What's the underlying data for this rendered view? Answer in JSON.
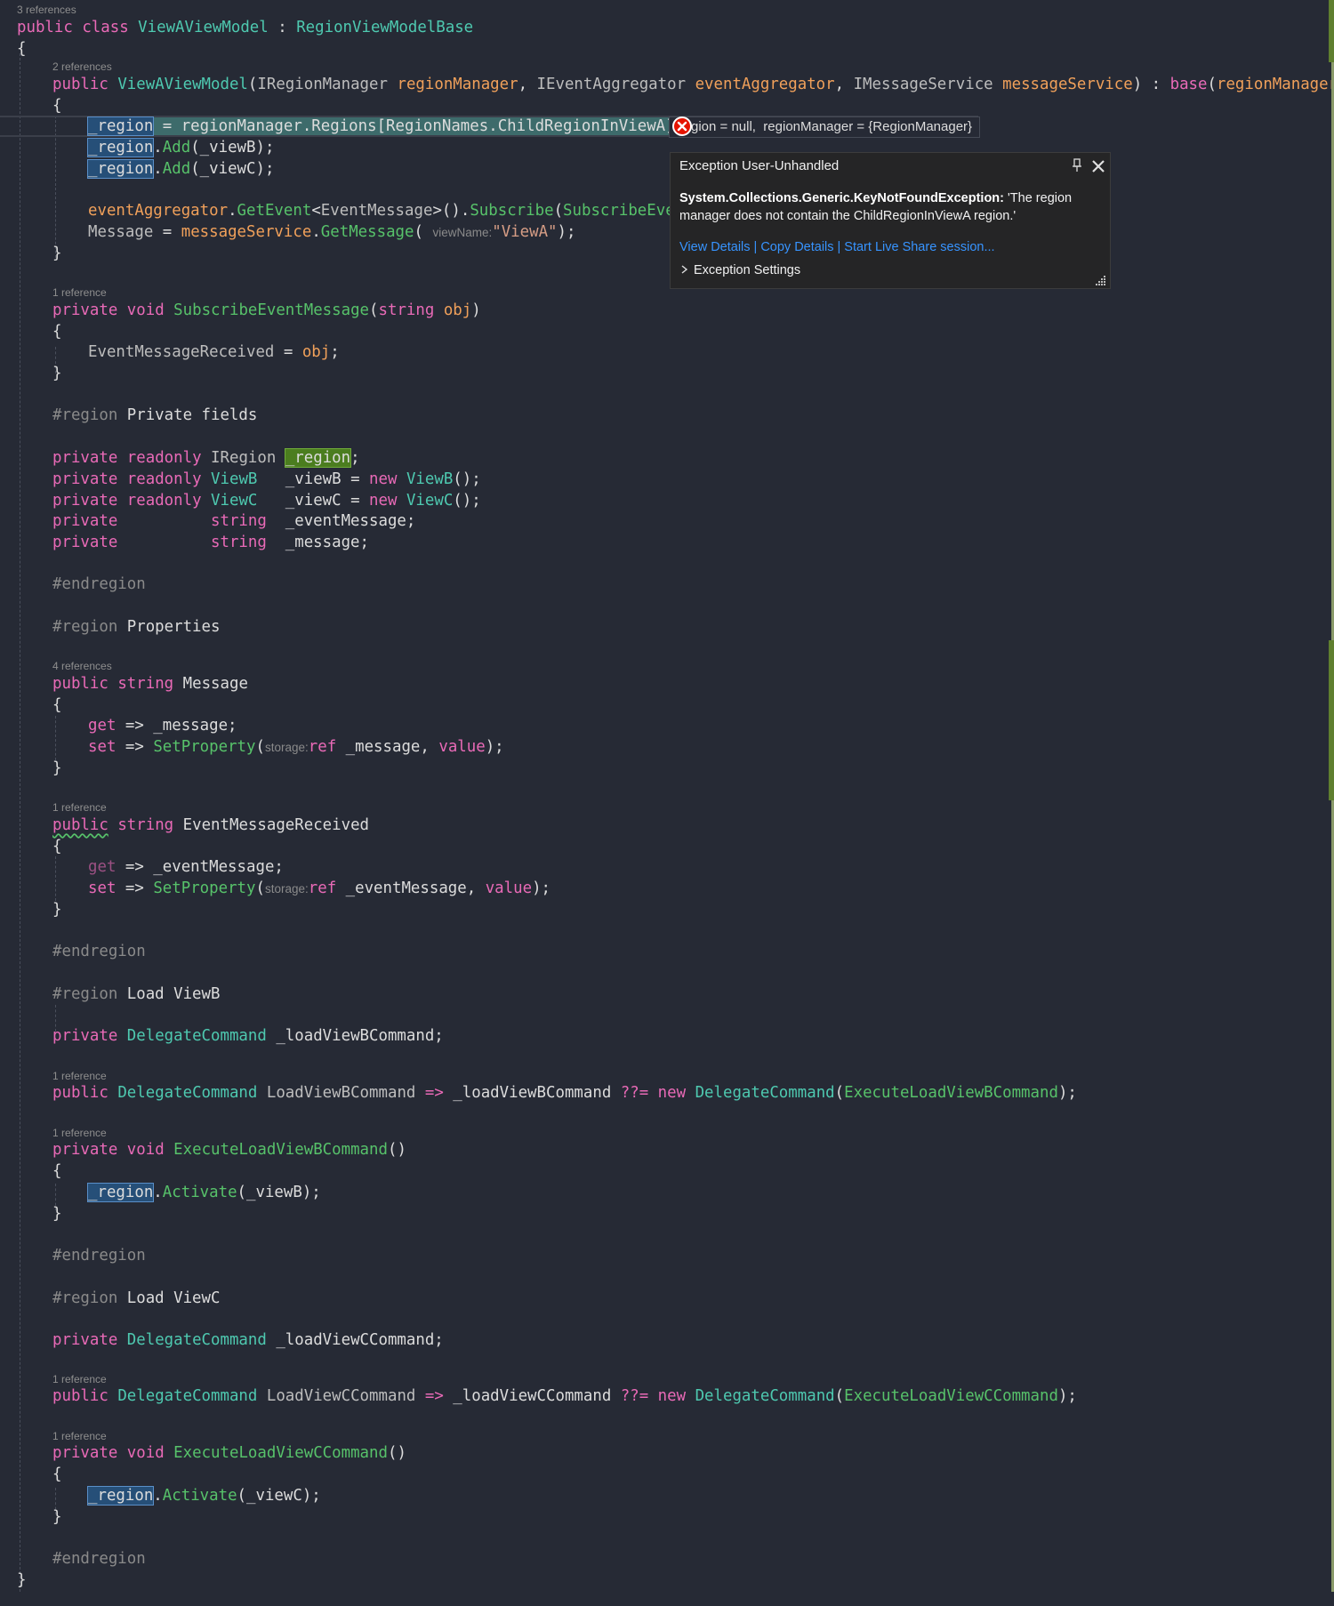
{
  "code": {
    "codelens": {
      "class_refs": "3 references",
      "ctor_refs": "2 references",
      "subscribe_refs": "1 reference",
      "message_refs": "4 references",
      "eventmsg_refs": "1 reference",
      "loadviewb_cmd_refs": "1 reference",
      "exec_loadviewb_refs": "1 reference",
      "loadviewc_cmd_refs": "1 reference",
      "exec_loadviewc_refs": "1 reference"
    },
    "lines": {
      "class_decl": [
        "public",
        "class",
        "ViewAViewModel",
        ":",
        "RegionViewModelBase"
      ],
      "ctor_sig": "public ViewAViewModel(IRegionManager regionManager, IEventAggregator eventAggregator, IMessageService messageService) : base(regionManager, ever",
      "ctor_line1": "_region = regionManager.Regions[RegionNames.ChildRegionInViewA];",
      "ctor_line2": "_region.Add(_viewB);",
      "ctor_line3": "_region.Add(_viewC);",
      "ctor_line4": "eventAggregator.GetEvent<EventMessage>().Subscribe(SubscribeEventM",
      "ctor_line5_hint": "viewName:",
      "ctor_line5": "Message = messageService.GetMessage( \"ViewA\");",
      "subscribe_sig": "private void SubscribeEventMessage(string obj)",
      "subscribe_body": "EventMessageReceived = obj;",
      "region_private": "#region Private fields",
      "field1": "private readonly IRegion _region;",
      "field2": "private readonly ViewB   _viewB = new ViewB();",
      "field3": "private readonly ViewC   _viewC = new ViewC();",
      "field4": "private          string  _eventMessage;",
      "field5": "private          string  _message;",
      "endregion": "#endregion",
      "region_properties": "#region Properties",
      "prop_message": "public string Message",
      "get_message": "get => _message;",
      "set_message_hint": "storage:",
      "set_message": "set => SetProperty( ref _message, value);",
      "prop_eventmsg": "public string EventMessageReceived",
      "get_eventmsg": "get => _eventMessage;",
      "set_eventmsg": "set => SetProperty( ref _eventMessage, value);",
      "region_loadb": "#region Load ViewB",
      "field_loadb": "private DelegateCommand _loadViewBCommand;",
      "prop_loadb": "public DelegateCommand LoadViewBCommand => _loadViewBCommand ??= new DelegateCommand(ExecuteLoadViewBCommand);",
      "exec_loadb_sig": "private void ExecuteLoadViewBCommand()",
      "exec_loadb_body": "_region.Activate(_viewB);",
      "region_loadc": "#region Load ViewC",
      "field_loadc": "private DelegateCommand _loadViewCCommand;",
      "prop_loadc": "public DelegateCommand LoadViewCCommand => _loadViewCCommand ??= new DelegateCommand(ExecuteLoadViewCCommand);",
      "exec_loadc_sig": "private void ExecuteLoadViewCCommand()",
      "exec_loadc_body": "_region.Activate(_viewC);",
      "brace_open": "{",
      "brace_close": "}"
    }
  },
  "datatip": {
    "text": "_region = null,  regionManager = {RegionManager}",
    "visible_text": "gion = null,  regionManager = {RegionManager}"
  },
  "exception": {
    "title": "Exception User-Unhandled",
    "exception_type": "System.Collections.Generic.KeyNotFoundException:",
    "message": " 'The region manager does not contain the ChildRegionInViewA region.'",
    "links": [
      "View Details",
      "Copy Details",
      "Start Live Share session..."
    ],
    "settings_label": "Exception Settings",
    "icons": [
      "pin-icon",
      "close-icon",
      "error-icon",
      "expand-triangle-icon",
      "resize-grip-icon"
    ]
  },
  "colors": {
    "background": "#262a35",
    "keyword": "#e96ab7",
    "type": "#4ec9b0",
    "method": "#57c26a",
    "parameter": "#f0a05a",
    "string": "#d69d85",
    "link": "#3794ff",
    "error": "#e51400"
  }
}
